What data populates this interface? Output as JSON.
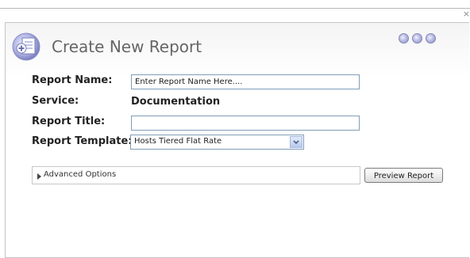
{
  "window": {
    "close_glyph": "×"
  },
  "header": {
    "title": "Create New Report",
    "logo_icon": "report-add-icon",
    "window_buttons": 3
  },
  "form": {
    "report_name": {
      "label": "Report Name:",
      "value": "Enter Report Name Here...."
    },
    "service": {
      "label": "Service:",
      "value": "Documentation"
    },
    "report_title": {
      "label": "Report Title:",
      "value": ""
    },
    "report_template": {
      "label": "Report Template:",
      "selected": "Hosts Tiered Flat Rate"
    }
  },
  "advanced": {
    "label": "Advanced Options",
    "expanded": false
  },
  "actions": {
    "preview_label": "Preview Report"
  },
  "colors": {
    "accent_purple": "#8d90c8",
    "input_border": "#7f9db9"
  }
}
